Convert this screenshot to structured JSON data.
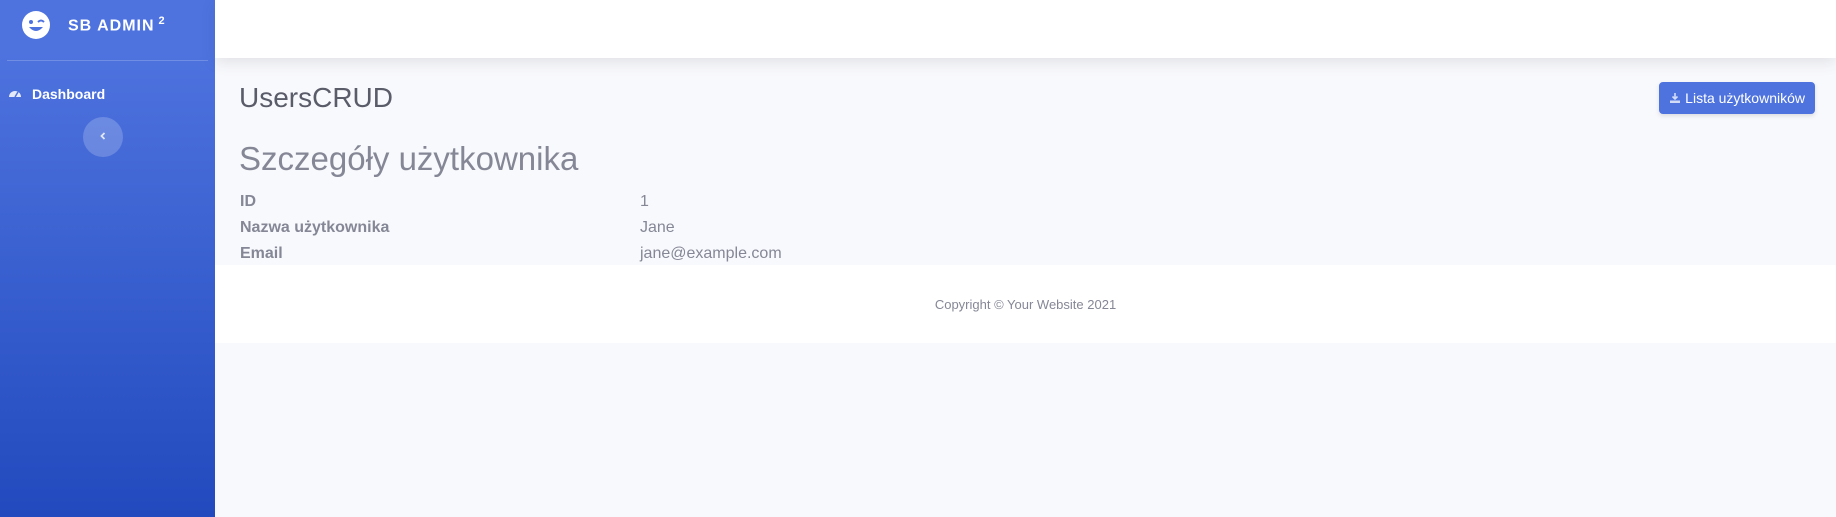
{
  "sidebar": {
    "brand": {
      "icon": "laugh-wink-icon",
      "name": "SB Admin",
      "sup": "2"
    },
    "items": [
      {
        "label": "Dashboard",
        "icon": "tachometer-icon"
      }
    ],
    "toggle_icon": "chevron-left-icon"
  },
  "header": {
    "title": "UsersCRUD",
    "action_button": {
      "label": "Lista użytkowników",
      "icon": "download-icon"
    }
  },
  "main": {
    "subtitle": "Szczegóły użytkownika",
    "details": [
      {
        "label": "ID",
        "value": "1"
      },
      {
        "label": "Nazwa użytkownika",
        "value": "Jane"
      },
      {
        "label": "Email",
        "value": "jane@example.com"
      }
    ]
  },
  "footer": {
    "text": "Copyright © Your Website 2021"
  },
  "colors": {
    "primary": "#4e73df",
    "gradient_end": "#224abe",
    "text": "#858796",
    "heading": "#5a5c69"
  }
}
